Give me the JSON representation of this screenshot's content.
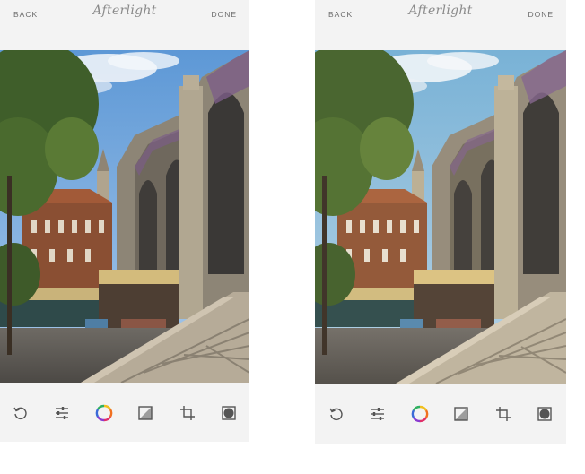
{
  "app": {
    "logo_text": "Afterlight"
  },
  "screens": [
    {
      "id": "left",
      "header": {
        "back_label": "BACK",
        "done_label": "DONE"
      },
      "photo": {
        "subject": "market-hall-photo-original"
      },
      "toolbar": {
        "tools": [
          {
            "icon": "undo-icon"
          },
          {
            "icon": "adjust-icon"
          },
          {
            "icon": "color-wheel-icon"
          },
          {
            "icon": "filter-icon"
          },
          {
            "icon": "crop-icon"
          },
          {
            "icon": "frame-icon"
          }
        ]
      }
    },
    {
      "id": "right",
      "header": {
        "back_label": "BACK",
        "done_label": "DONE"
      },
      "photo": {
        "subject": "market-hall-photo-edited"
      },
      "toolbar": {
        "tools": [
          {
            "icon": "undo-icon"
          },
          {
            "icon": "adjust-icon"
          },
          {
            "icon": "color-wheel-icon"
          },
          {
            "icon": "filter-icon"
          },
          {
            "icon": "crop-icon"
          },
          {
            "icon": "frame-icon"
          }
        ]
      }
    }
  ],
  "colors": {
    "chrome_background": "#f3f3f3",
    "chrome_text": "#6b6b6b",
    "icon_stroke": "#555555",
    "sky": "#6fa3d8",
    "foliage": "#3f5e2a",
    "stone": "#9a8f7c",
    "brick": "#8a4f33"
  }
}
